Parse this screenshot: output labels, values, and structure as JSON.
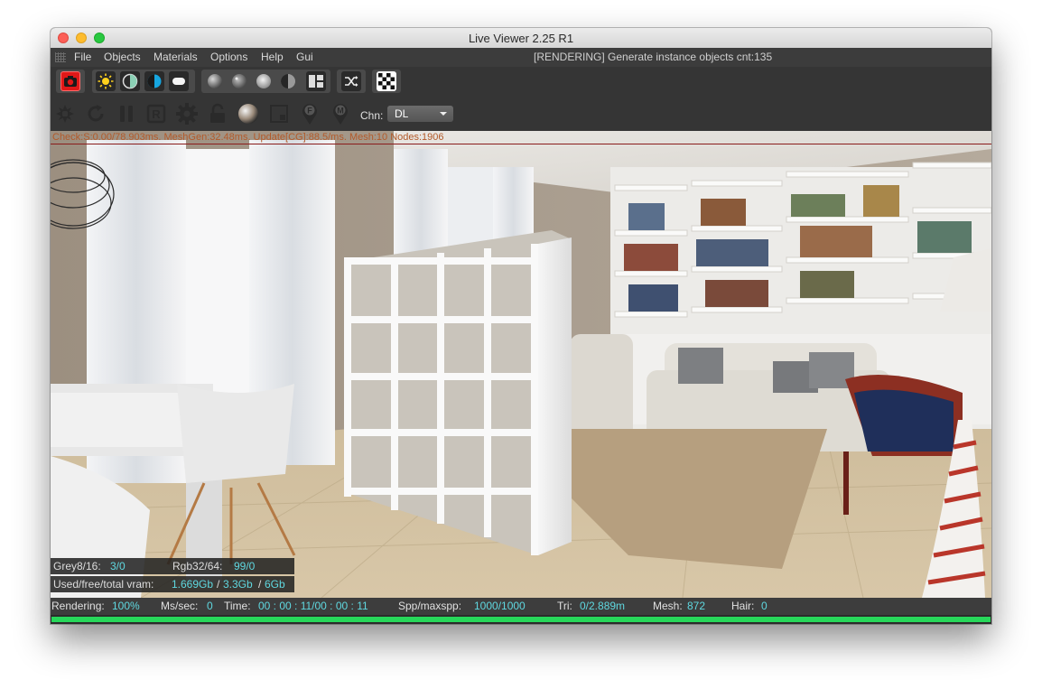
{
  "window": {
    "title": "Live Viewer 2.25 R1"
  },
  "menu": {
    "items": [
      "File",
      "Objects",
      "Materials",
      "Options",
      "Help",
      "Gui"
    ]
  },
  "status_message": "[RENDERING] Generate instance objects cnt:135",
  "toolbar": {
    "channel_label": "Chn:",
    "channel_value": "DL"
  },
  "viewport": {
    "debug_text": "Check:S:0.00/78.903ms. MeshGen:32.48ms. Update[CG]:88.5/ms. Mesh:10 Nodes:1906",
    "overlay": {
      "grey_label": "Grey8/16:",
      "grey_value": "3/0",
      "rgb_label": "Rgb32/64:",
      "rgb_value": "99/0",
      "vram_label": "Used/free/total vram:",
      "vram_used": "1.669Gb",
      "vram_free": "3.3Gb",
      "vram_total": "6Gb",
      "slash": "/"
    }
  },
  "statusbar": {
    "rendering_label": "Rendering:",
    "rendering_value": "100%",
    "ms_label": "Ms/sec:",
    "ms_value": "0",
    "time_label": "Time:",
    "time_value": "00 : 00 : 11/00 : 00 : 11",
    "spp_label": "Spp/maxspp:",
    "spp_value": "1000/1000",
    "tri_label": "Tri:",
    "tri_value": "0/2.889m",
    "mesh_label": "Mesh:",
    "mesh_value": "872",
    "hair_label": "Hair:",
    "hair_value": "0"
  },
  "progress": {
    "fraction": 1.0
  },
  "colors": {
    "accent_green": "#27d85a",
    "value_cyan": "#5fd8e0",
    "record_red": "#e01818"
  }
}
